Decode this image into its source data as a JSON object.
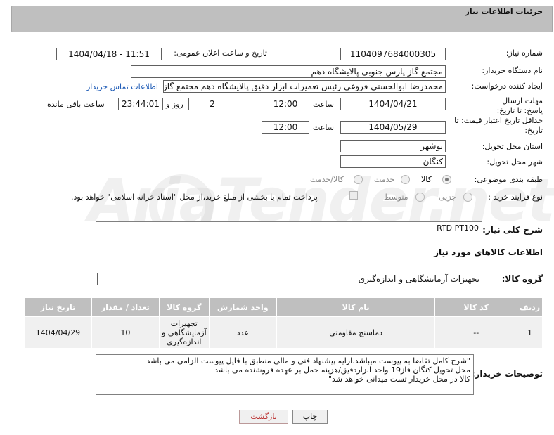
{
  "header": {
    "title": "جزئیات اطلاعات نیاز"
  },
  "fields": {
    "need_number_label": "شماره نیاز:",
    "need_number": "1104097684000305",
    "announce_label": "تاریخ و ساعت اعلان عمومی:",
    "announce_value": "1404/04/18 - 11:51",
    "buyer_org_label": "نام دستگاه خریدار:",
    "buyer_org": "مجتمع گاز پارس جنوبی  پالایشگاه دهم",
    "creator_label": "ایجاد کننده درخواست:",
    "creator": "محمدرضا ابوالحسنی فروغی رئیس تعمیرات ابزار دقیق پالایشگاه دهم  مجتمع گاز",
    "buyer_contact_link": "اطلاعات تماس خریدار",
    "reply_deadline_label": "مهلت ارسال پاسخ: تا تاریخ:",
    "reply_date": "1404/04/21",
    "time_label": "ساعت",
    "reply_time": "12:00",
    "days_value": "2",
    "days_label": "روز و",
    "remaining_time": "23:44:01",
    "remaining_label": "ساعت باقی مانده",
    "price_validity_label": "حداقل تاریخ اعتبار قیمت: تا تاریخ:",
    "price_date": "1404/05/29",
    "price_time": "12:00",
    "province_label": "استان محل تحویل:",
    "province": "بوشهر",
    "city_label": "شهر محل تحویل:",
    "city": "کنگان",
    "category_label": "طبقه بندی موضوعی:",
    "category_options": [
      "کالا",
      "خدمت",
      "کالا/خدمت"
    ],
    "process_label": "نوع فرآیند خرید :",
    "process_options": [
      "جزیی",
      "متوسط"
    ],
    "payment_note": "پرداخت تمام یا بخشی از مبلغ خرید،از محل \"اسناد خزانه اسلامی\" خواهد بود.",
    "summary_label": "شرح کلی نیاز:",
    "summary_value": "RTD PT100",
    "goods_info_title": "اطلاعات کالاهای مورد نیاز",
    "goods_group_label": "گروه کالا:",
    "goods_group_value": "تجهیزات آزمایشگاهی و اندازه‌گیری"
  },
  "table": {
    "headers": [
      "ردیف",
      "کد کالا",
      "نام کالا",
      "واحد شمارش",
      "گروه کالا",
      "تعداد / مقدار",
      "تاریخ نیاز"
    ],
    "rows": [
      [
        "1",
        "--",
        "دماسنج مقاومتی",
        "عدد",
        "تجهیزات آزمایشگاهی و اندازه‌گیری",
        "10",
        "1404/04/29"
      ]
    ]
  },
  "buyer_notes": {
    "label": "توضیحات خریدار:",
    "lines": [
      "\"شرح کامل تقاضا به پیوست میباشد.ارایه پیشنهاد فنی و مالی منطبق با فایل پیوست الزامی می باشد",
      "محل تحویل کنگان فاز19 واحد ابزاردقیق/هزینه حمل بر عهده فروشنده می باشد",
      "کالا در محل خریدار تست میدانی خواهد شد\""
    ]
  },
  "buttons": {
    "print": "چاپ",
    "back": "بازگشت"
  },
  "watermark": "AriaTender.net"
}
